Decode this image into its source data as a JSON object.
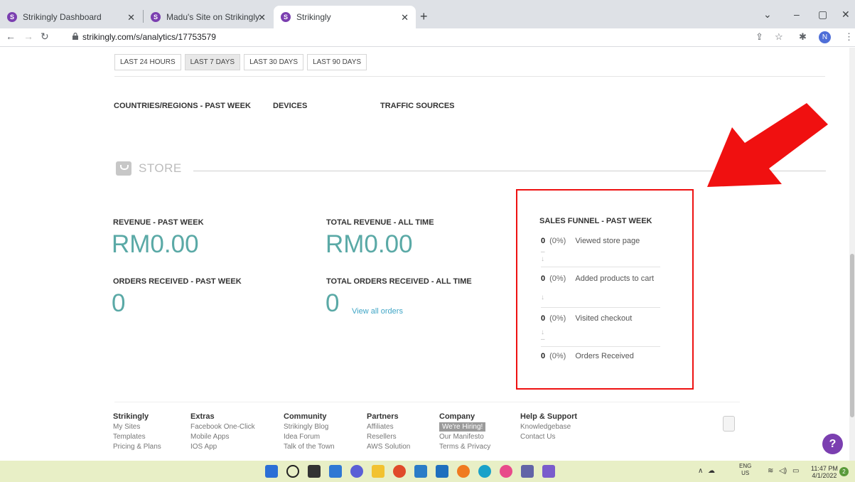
{
  "browser": {
    "tabs": [
      {
        "label": "Strikingly Dashboard",
        "favicon": "S"
      },
      {
        "label": "Madu's Site on Strikingly",
        "favicon": "S"
      },
      {
        "label": "Strikingly",
        "favicon": "S"
      }
    ],
    "url": "strikingly.com/s/analytics/17753579",
    "profile_initial": "N"
  },
  "ranges": [
    "LAST 24 HOURS",
    "LAST 7 DAYS",
    "LAST 30 DAYS",
    "LAST 90 DAYS"
  ],
  "sub_headers": {
    "countries": "COUNTRIES/REGIONS - PAST WEEK",
    "devices": "DEVICES",
    "traffic": "TRAFFIC SOURCES"
  },
  "store": {
    "title": "STORE",
    "revenue_label": "REVENUE - PAST WEEK",
    "revenue_value": "RM0.00",
    "total_revenue_label": "TOTAL REVENUE - ALL TIME",
    "total_revenue_value": "RM0.00",
    "orders_label": "ORDERS RECEIVED - PAST WEEK",
    "orders_value": "0",
    "total_orders_label": "TOTAL ORDERS RECEIVED - ALL TIME",
    "total_orders_value": "0",
    "view_orders_link": "View all orders"
  },
  "funnel": {
    "title": "SALES FUNNEL - PAST WEEK",
    "steps": [
      {
        "count": "0",
        "pct": "(0%)",
        "label": "Viewed store page"
      },
      {
        "count": "0",
        "pct": "(0%)",
        "label": "Added products to cart"
      },
      {
        "count": "0",
        "pct": "(0%)",
        "label": "Visited checkout"
      },
      {
        "count": "0",
        "pct": "(0%)",
        "label": "Orders Received"
      }
    ]
  },
  "footer": {
    "strikingly": {
      "title": "Strikingly",
      "items": [
        "My Sites",
        "Templates",
        "Pricing & Plans"
      ]
    },
    "extras": {
      "title": "Extras",
      "items": [
        "Facebook One-Click",
        "Mobile Apps",
        "IOS App"
      ]
    },
    "community": {
      "title": "Community",
      "items": [
        "Strikingly Blog",
        "Idea Forum",
        "Talk of the Town"
      ]
    },
    "partners": {
      "title": "Partners",
      "items": [
        "Affiliates",
        "Resellers",
        "AWS Solution"
      ]
    },
    "company": {
      "title": "Company",
      "items": [
        "We're Hiring!",
        "Our Manifesto",
        "Terms & Privacy"
      ]
    },
    "help": {
      "title": "Help & Support",
      "items": [
        "Knowledgebase",
        "Contact Us"
      ]
    }
  },
  "help_button": "?",
  "taskbar": {
    "lang": "ENG",
    "region": "US",
    "time": "11:47 PM",
    "date": "4/1/2022",
    "notif_count": "2"
  }
}
